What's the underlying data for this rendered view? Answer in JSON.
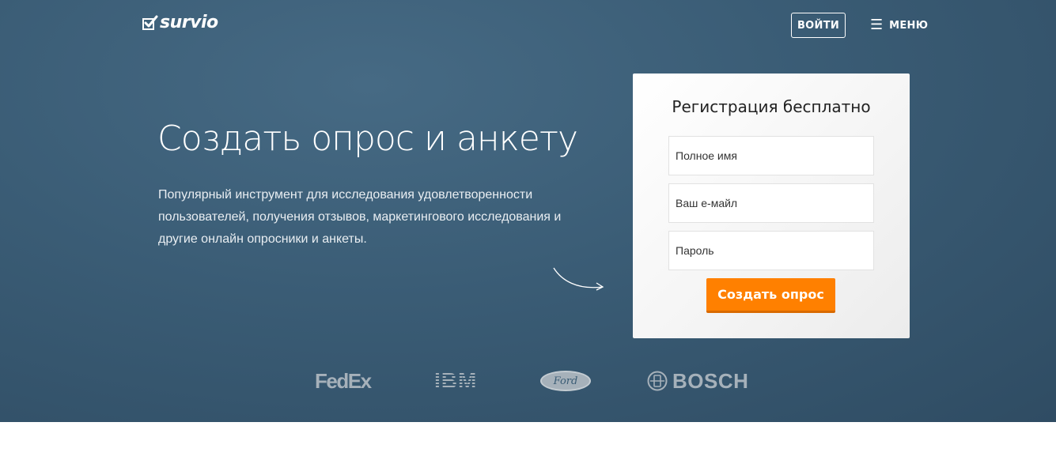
{
  "header": {
    "logo_text": "survio",
    "login_label": "ВОЙТИ",
    "menu_label": "МЕНЮ"
  },
  "hero": {
    "headline": "Создать опрос и анкету",
    "description": "Популярный инструмент для исследования удовлетворенности пользователей, получения отзывов, маркетингового исследования и другие онлайн опросники и анкеты."
  },
  "signup": {
    "title": "Регистрация бесплатно",
    "name_placeholder": "Полное имя",
    "email_placeholder": "Ваш e-майл",
    "password_placeholder": "Пароль",
    "submit_label": "Создать опрос"
  },
  "brands": {
    "fedex": "FedEx",
    "ibm": "IBM",
    "ford": "Ford",
    "bosch": "BOSCH"
  },
  "colors": {
    "hero_background": "#3a5c75",
    "cta_orange": "#ff8000",
    "brand_logo_gray": "#a6b1ba"
  }
}
